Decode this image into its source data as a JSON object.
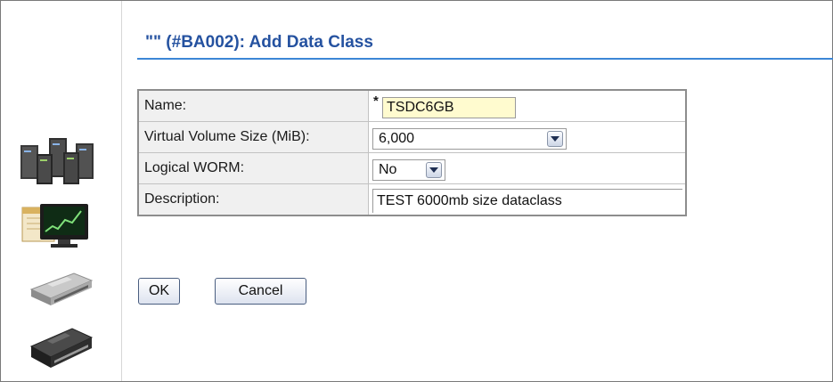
{
  "page": {
    "title": "\"\" (#BA002): Add Data Class"
  },
  "nav": {
    "icons": [
      {
        "name": "server-rack-icon"
      },
      {
        "name": "monitor-chart-icon"
      },
      {
        "name": "tape-drive-icon"
      },
      {
        "name": "tape-drive-dark-icon"
      }
    ]
  },
  "form": {
    "name_label": "Name:",
    "name_required_mark": "*",
    "name_value": "TSDC6GB",
    "volume_size_label": "Virtual Volume Size (MiB):",
    "volume_size_value": "6,000",
    "worm_label": "Logical WORM:",
    "worm_value": "No",
    "description_label": "Description:",
    "description_value": "TEST 6000mb size dataclass"
  },
  "buttons": {
    "ok_label": "OK",
    "cancel_label": "Cancel"
  },
  "colors": {
    "title": "#2552a0",
    "rule": "#3c86d6",
    "required_field_bg": "#fffbcf",
    "label_cell_bg": "#f0f0f0"
  }
}
